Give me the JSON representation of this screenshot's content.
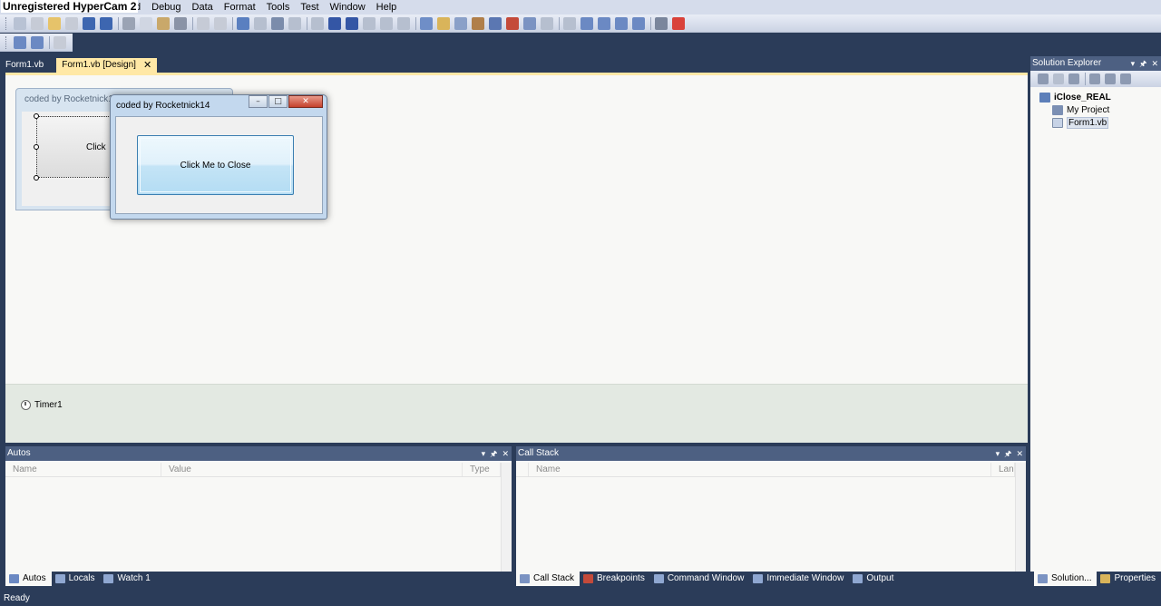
{
  "watermark": "Unregistered HyperCam 2",
  "menu": [
    "Build",
    "Debug",
    "Data",
    "Format",
    "Tools",
    "Test",
    "Window",
    "Help"
  ],
  "menu_visible": [
    "uild",
    "Debug",
    "Data",
    "Format",
    "Tools",
    "Test",
    "Window",
    "Help"
  ],
  "doc_tabs": [
    {
      "label": "Form1.vb",
      "active": false
    },
    {
      "label": "Form1.vb [Design]",
      "active": true,
      "close": "✕"
    }
  ],
  "design_form": {
    "title": "coded by Rocketnick1",
    "button_partial": "Click"
  },
  "running_form": {
    "title": "coded by Rocketnick14",
    "button": "Click Me to Close",
    "min": "–",
    "max": "□",
    "close": "✕"
  },
  "component_tray": {
    "timer": "Timer1"
  },
  "solution_explorer": {
    "title": "Solution Explorer",
    "solution": "iClose_REAL",
    "items": [
      "My Project",
      "Form1.vb"
    ]
  },
  "autos": {
    "title": "Autos",
    "columns": [
      "Name",
      "Value",
      "Type"
    ]
  },
  "callstack": {
    "title": "Call Stack",
    "columns": [
      "Name",
      "Lang"
    ]
  },
  "pane_controls": {
    "dropdown": "▾",
    "pin": "🖈",
    "close": "✕"
  },
  "bottom_tabs_left": [
    "Autos",
    "Locals",
    "Watch 1"
  ],
  "bottom_tabs_mid": [
    "Call Stack",
    "Breakpoints",
    "Command Window",
    "Immediate Window",
    "Output"
  ],
  "bottom_tabs_right": [
    "Solution...",
    "Properties"
  ],
  "status": "Ready",
  "colors": {
    "accent_tab": "#ffe8a6",
    "chrome": "#2b3c59",
    "pane_header": "#4d6082",
    "button_border": "#3c7fb1",
    "close_red": "#c4412c"
  }
}
